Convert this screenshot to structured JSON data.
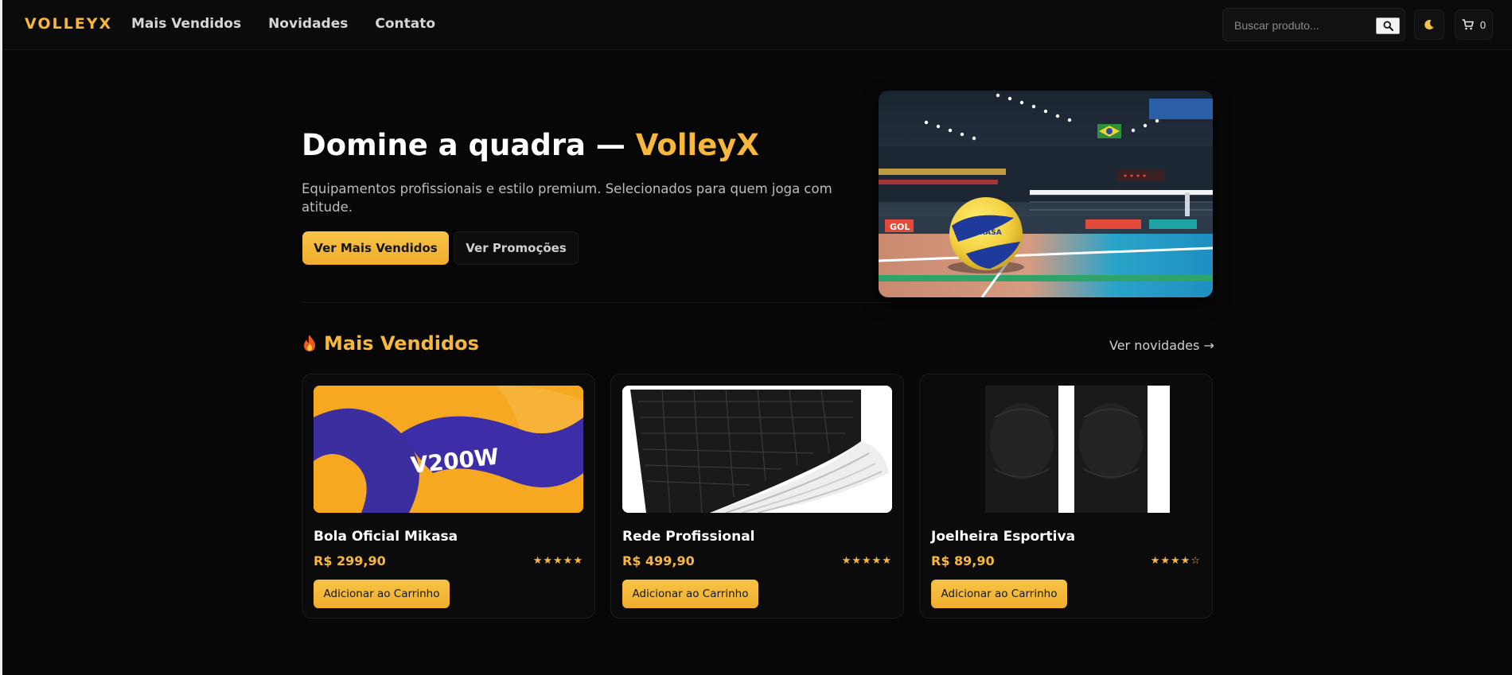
{
  "header": {
    "logo": "VOLLEYX",
    "nav": [
      "Mais Vendidos",
      "Novidades",
      "Contato"
    ],
    "search_placeholder": "Buscar produto...",
    "cart_count": "0",
    "icons": {
      "search": "search-icon",
      "theme": "moon-icon",
      "cart": "cart-icon"
    }
  },
  "hero": {
    "title_prefix": "Domine a quadra — ",
    "title_brand": "VolleyX",
    "subtitle": "Equipamentos profissionais e estilo premium. Selecionados para quem joga com atitude.",
    "primary_button": "Ver Mais Vendidos",
    "secondary_button": "Ver Promoções",
    "image_text": {
      "ball_brand": "MIKASA",
      "banner": "GOL"
    }
  },
  "section": {
    "title": "Mais Vendidos",
    "icon": "fire-icon",
    "link": "Ver novidades →"
  },
  "products": [
    {
      "name": "Bola Oficial Mikasa",
      "price": "R$ 299,90",
      "rating": 5,
      "stars": "★★★★★",
      "button": "Adicionar ao Carrinho",
      "image_text": "V200W"
    },
    {
      "name": "Rede Profissional",
      "price": "R$ 499,90",
      "rating": 5,
      "stars": "★★★★★",
      "button": "Adicionar ao Carrinho"
    },
    {
      "name": "Joelheira Esportiva",
      "price": "R$ 89,90",
      "rating": 4,
      "stars": "★★★★☆",
      "button": "Adicionar ao Carrinho"
    }
  ],
  "colors": {
    "accent": "#f6b73c",
    "background": "#070707",
    "card": "#0b0b0b"
  }
}
